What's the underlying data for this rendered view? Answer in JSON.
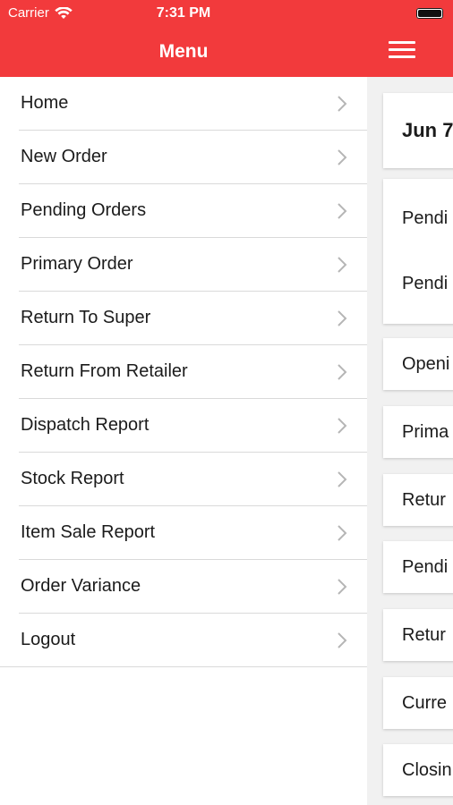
{
  "status_bar": {
    "carrier": "Carrier",
    "time": "7:31 PM"
  },
  "menu": {
    "title": "Menu",
    "items": [
      {
        "label": "Home"
      },
      {
        "label": "New Order"
      },
      {
        "label": "Pending Orders"
      },
      {
        "label": "Primary Order"
      },
      {
        "label": "Return To Super"
      },
      {
        "label": "Return From Retailer"
      },
      {
        "label": "Dispatch Report"
      },
      {
        "label": "Stock Report"
      },
      {
        "label": "Item Sale Report"
      },
      {
        "label": "Order Variance"
      },
      {
        "label": "Logout"
      }
    ]
  },
  "content": {
    "date_card": "Jun 7",
    "group_card": [
      "Pendi",
      "Pendi"
    ],
    "cards": [
      "Openi",
      "Prima",
      "Retur",
      "Pendi",
      "Retur",
      "Curre",
      "Closin"
    ]
  },
  "colors": {
    "accent": "#f23a3c",
    "background": "#ffffff",
    "content_background": "#f1f1f1"
  }
}
